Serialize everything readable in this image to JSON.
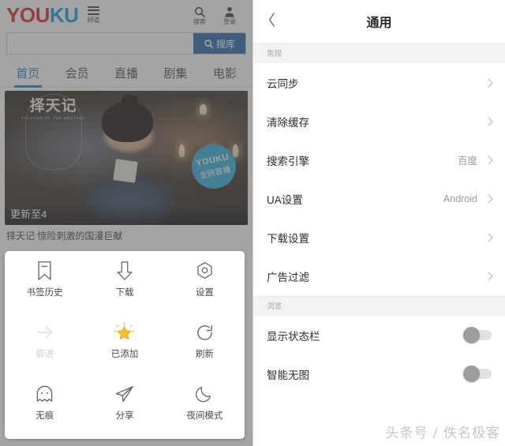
{
  "left": {
    "topbar": {
      "logo_you": "YOU",
      "logo_ku": "KU",
      "channel_label": "频道",
      "search_label": "搜索",
      "login_label": "登录"
    },
    "search": {
      "value": "",
      "placeholder": "",
      "button_label": "搜库"
    },
    "tabs": [
      {
        "label": "首页",
        "active": true
      },
      {
        "label": "会员",
        "active": false
      },
      {
        "label": "直播",
        "active": false
      },
      {
        "label": "剧集",
        "active": false
      },
      {
        "label": "电影",
        "active": false
      }
    ],
    "hero": {
      "title_cn": "择天记",
      "title_en": "FIGHTER OF THE DESTINY",
      "badge_top": "YOUKU",
      "badge_bottom": "全网首播",
      "update_label": "更新至4",
      "caption": "择天记 惊险刺激的国漫巨献"
    },
    "sheet": {
      "items": [
        {
          "icon": "bookmark-icon",
          "label": "书签历史",
          "disabled": false
        },
        {
          "icon": "download-icon",
          "label": "下载",
          "disabled": false
        },
        {
          "icon": "settings-icon",
          "label": "设置",
          "disabled": false
        },
        {
          "icon": "forward-icon",
          "label": "前进",
          "disabled": true
        },
        {
          "icon": "star-icon",
          "label": "已添加",
          "disabled": false
        },
        {
          "icon": "refresh-icon",
          "label": "刷新",
          "disabled": false
        },
        {
          "icon": "ghost-icon",
          "label": "无痕",
          "disabled": false
        },
        {
          "icon": "share-icon",
          "label": "分享",
          "disabled": false
        },
        {
          "icon": "moon-icon",
          "label": "夜间模式",
          "disabled": false
        }
      ]
    }
  },
  "right": {
    "header": {
      "title": "通用",
      "back_icon": "back-chevron-icon"
    },
    "sections": [
      {
        "title": "常规",
        "rows": [
          {
            "label": "云同步",
            "value": "",
            "type": "chevron"
          },
          {
            "label": "清除缓存",
            "value": "",
            "type": "chevron"
          },
          {
            "label": "搜索引擎",
            "value": "百度",
            "type": "chevron"
          },
          {
            "label": "UA设置",
            "value": "Android",
            "type": "chevron"
          },
          {
            "label": "下载设置",
            "value": "",
            "type": "chevron"
          },
          {
            "label": "广告过滤",
            "value": "",
            "type": "chevron"
          }
        ]
      },
      {
        "title": "浏览",
        "rows": [
          {
            "label": "显示状态栏",
            "value": "",
            "type": "toggle",
            "on": false
          },
          {
            "label": "智能无图",
            "value": "",
            "type": "toggle",
            "on": false
          }
        ]
      }
    ],
    "watermark": "头条号 / 佚名极客"
  },
  "colors": {
    "brand_red": "#d8232a",
    "brand_blue": "#00a0e9",
    "search_button": "#2163a8",
    "tab_active": "#1a7fc1",
    "badge": "#2eaedb",
    "star": "#f5c22b"
  }
}
